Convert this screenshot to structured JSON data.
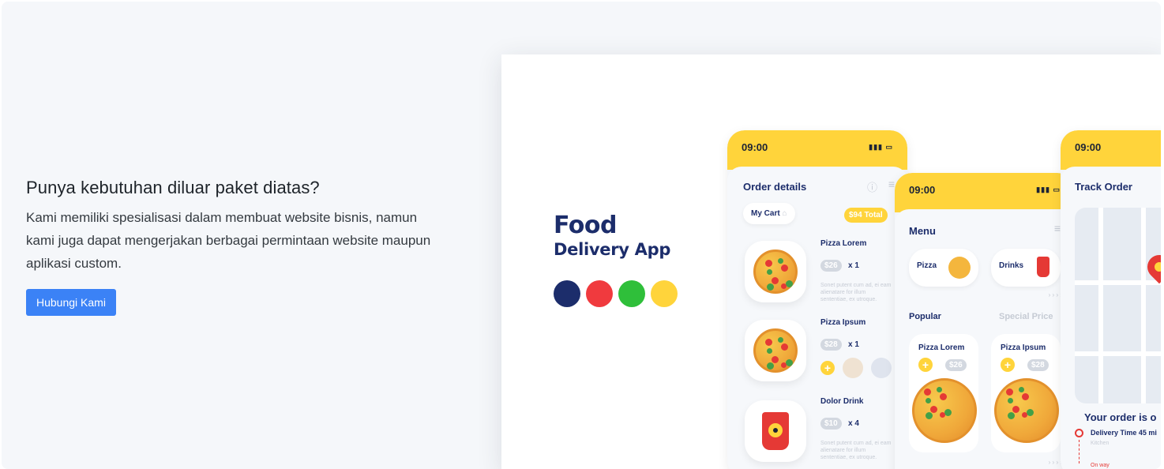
{
  "cta": {
    "heading": "Punya kebutuhan diluar paket diatas?",
    "description": "Kami memiliki spesialisasi dalam membuat website bisnis, namun kami juga dapat mengerjakan berbagai permintaan website maupun aplikasi custom.",
    "button_label": "Hubungi Kami",
    "button_color": "#3b82f6"
  },
  "showcase": {
    "brand_line1": "Food",
    "brand_line2": "Delivery App",
    "swatches": [
      "#1c2d6b",
      "#f03a3e",
      "#2fbf3a",
      "#ffd43b"
    ],
    "phone_order": {
      "time": "09:00",
      "title": "Order details",
      "cart_label": "My Cart",
      "total": "$94 Total",
      "items": [
        {
          "name": "Pizza Lorem",
          "price": "$26",
          "qty": "x 1",
          "desc": "Sonet putent cum ad, ei eam alienatare for illum sententiae, ex utroque."
        },
        {
          "name": "Pizza Ipsum",
          "price": "$28",
          "qty": "x 1"
        },
        {
          "name": "Dolor Drink",
          "price": "$10",
          "qty": "x 4",
          "desc": "Sonet putent cum ad, ei eam alienatare for illum sententiae, ex utroque."
        }
      ]
    },
    "phone_menu": {
      "time": "09:00",
      "title": "Menu",
      "categories": [
        "Pizza",
        "Drinks"
      ],
      "tabs": [
        "Popular",
        "Special Price"
      ],
      "products": [
        {
          "name": "Pizza Lorem",
          "price": "$26"
        },
        {
          "name": "Pizza Ipsum",
          "price": "$28"
        }
      ],
      "more": "› › › ›"
    },
    "phone_track": {
      "time": "09:00",
      "title": "Track Order",
      "status": "Your order is o",
      "delivery": "Delivery Time 45 mi",
      "step1": "Kitchen",
      "step2": "On way"
    }
  }
}
